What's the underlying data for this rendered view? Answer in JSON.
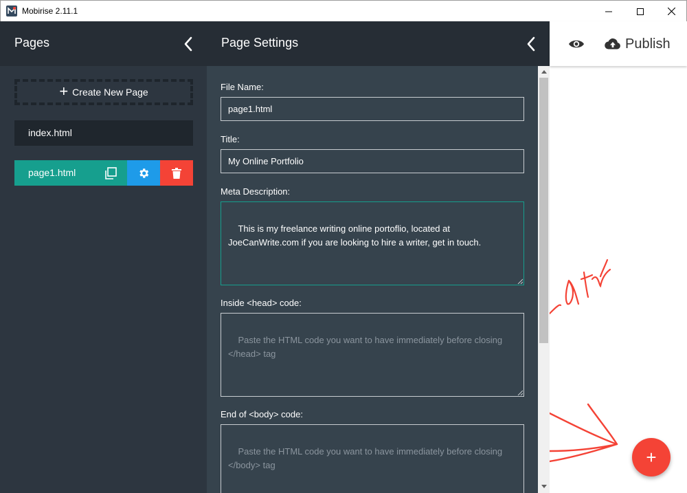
{
  "window": {
    "title": "Mobirise 2.11.1"
  },
  "pages_panel": {
    "title": "Pages",
    "create_label": "Create New Page",
    "pages": [
      {
        "name": "index.html",
        "active": false
      },
      {
        "name": "page1.html",
        "active": true
      }
    ]
  },
  "settings_panel": {
    "title": "Page Settings",
    "file_name": {
      "label": "File Name:",
      "value": "page1.html"
    },
    "title_field": {
      "label": "Title:",
      "value": "My Online Portfolio"
    },
    "meta_description": {
      "label": "Meta Description:",
      "value": "This is my freelance writing online portoflio, located at JoeCanWrite.com if you are looking to hire a writer, get in touch."
    },
    "head_code": {
      "label": "Inside <head> code:",
      "placeholder": "Paste the HTML code you want to have immediately before closing </head> tag"
    },
    "body_code": {
      "label": "End of <body> code:",
      "placeholder": "Paste the HTML code you want to have immediately before closing </body> tag"
    }
  },
  "topbar": {
    "publish_label": "Publish"
  },
  "preview": {
    "handwriting": "start",
    "add_label": "+"
  },
  "colors": {
    "accent": "#169f8e",
    "blue": "#1e9be9",
    "red": "#f44336",
    "panel_dark": "#2d3640",
    "panel_mid": "#36434d"
  }
}
